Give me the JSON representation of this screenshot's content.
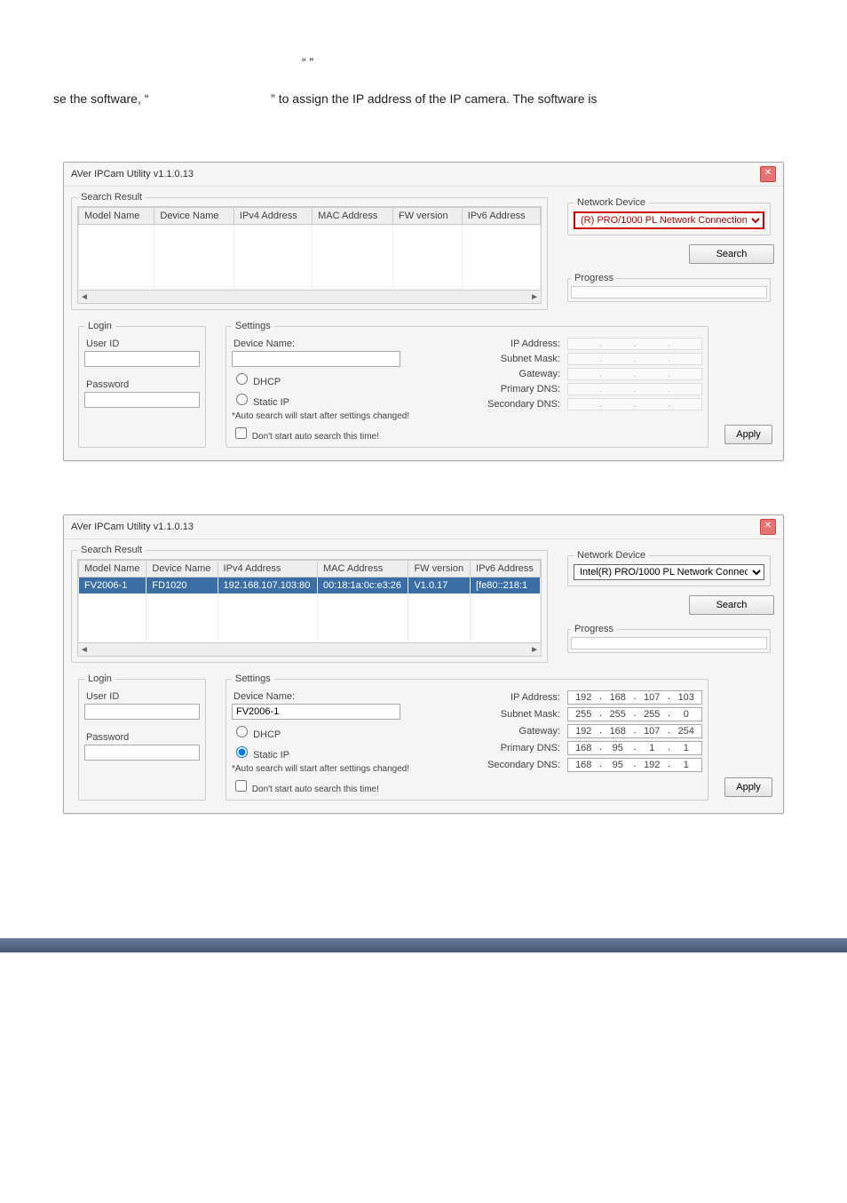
{
  "intro": {
    "quote_line": "“                                         ”",
    "line2_prefix": "se the software, “",
    "line2_suffix": "” to assign the IP address of the IP camera. The software is"
  },
  "window1": {
    "title": "AVer IPCam Utility v1.1.0.13",
    "search_result": "Search Result",
    "cols": {
      "model": "Model Name",
      "device": "Device Name",
      "ipv4": "IPv4 Address",
      "mac": "MAC Address",
      "fw": "FW version",
      "ipv6": "IPv6 Address"
    },
    "network_device": "Network Device",
    "net_select": "(R) PRO/1000 PL Network Connection",
    "search_btn": "Search",
    "progress": "Progress",
    "login": "Login",
    "user_id": "User ID",
    "password": "Password",
    "settings": "Settings",
    "device_name": "Device Name:",
    "dhcp": "DHCP",
    "static": "Static IP",
    "note1": "*Auto search will start after settings changed!",
    "note2": "Don't start auto search this time!",
    "ip_address": "IP Address:",
    "subnet": "Subnet Mask:",
    "gateway": "Gateway:",
    "pdns": "Primary DNS:",
    "sdns": "Secondary DNS:",
    "apply": "Apply"
  },
  "window2": {
    "title": "AVer IPCam Utility v1.1.0.13",
    "search_result": "Search Result",
    "cols": {
      "model": "Model Name",
      "device": "Device Name",
      "ipv4": "IPv4 Address",
      "mac": "MAC Address",
      "fw": "FW version",
      "ipv6": "IPv6 Address"
    },
    "row": {
      "model": "FV2006-1",
      "device": "FD1020",
      "ipv4": "192.168.107.103:80",
      "mac": "00:18:1a:0c:e3:26",
      "fw": "V1.0.17",
      "ipv6": "[fe80::218:1"
    },
    "network_device": "Network Device",
    "net_select": "Intel(R) PRO/1000 PL Network Connec",
    "search_btn": "Search",
    "progress": "Progress",
    "login": "Login",
    "user_id": "User ID",
    "password": "Password",
    "settings": "Settings",
    "device_name": "Device Name:",
    "device_name_val": "FV2006-1",
    "dhcp": "DHCP",
    "static": "Static IP",
    "note1": "*Auto search will start after settings changed!",
    "note2": "Don't start auto search this time!",
    "ip_address": "IP Address:",
    "subnet": "Subnet Mask:",
    "gateway": "Gateway:",
    "pdns": "Primary DNS:",
    "sdns": "Secondary DNS:",
    "apply": "Apply",
    "ip": {
      "a": "192",
      "b": "168",
      "c": "107",
      "d": "103"
    },
    "sm": {
      "a": "255",
      "b": "255",
      "c": "255",
      "d": "0"
    },
    "gw": {
      "a": "192",
      "b": "168",
      "c": "107",
      "d": "254"
    },
    "p": {
      "a": "168",
      "b": "95",
      "c": "1",
      "d": "1"
    },
    "s": {
      "a": "168",
      "b": "95",
      "c": "192",
      "d": "1"
    }
  }
}
